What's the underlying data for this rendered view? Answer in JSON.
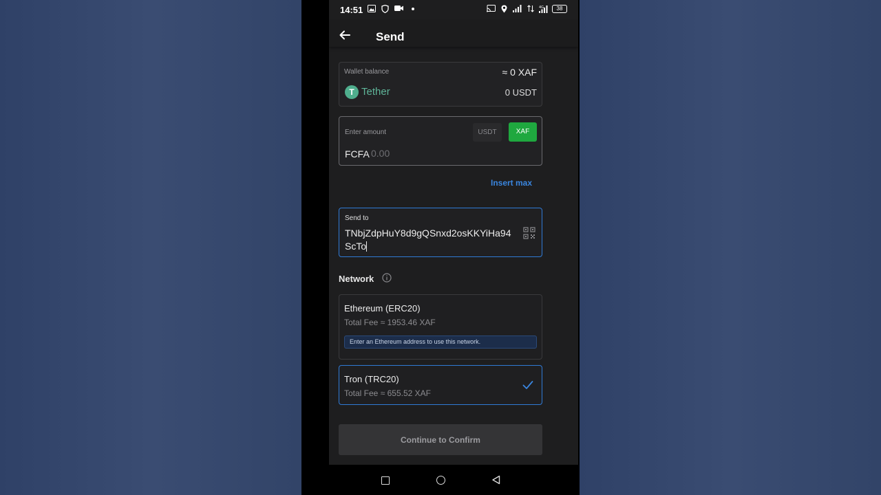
{
  "status_bar": {
    "time": "14:51",
    "battery": "38",
    "network_type": "4G"
  },
  "header": {
    "title": "Send",
    "back_icon": "arrow-left-icon"
  },
  "wallet": {
    "label": "Wallet balance",
    "fiat_balance": "≈ 0 XAF",
    "token_name": "Tether",
    "token_balance": "0 USDT",
    "token_icon_glyph": "T"
  },
  "amount": {
    "label": "Enter amount",
    "unit_options": [
      "USDT",
      "XAF"
    ],
    "selected_unit": "XAF",
    "currency_prefix": "FCFA",
    "placeholder": "0.00",
    "value": ""
  },
  "insert_max_label": "Insert max",
  "send_to": {
    "label": "Send to",
    "address": "TNbjZdpHuY8d9gQSnxd2osKKYiHa94ScTo"
  },
  "network": {
    "heading": "Network",
    "options": [
      {
        "name": "Ethereum (ERC20)",
        "fee": "Total Fee ≈ 1953.46 XAF",
        "warning": "Enter an Ethereum address to use this network.",
        "selected": false
      },
      {
        "name": "Tron (TRC20)",
        "fee": "Total Fee ≈ 655.52 XAF",
        "selected": true
      }
    ]
  },
  "continue_label": "Continue to Confirm",
  "colors": {
    "accent_green": "#1fa83f",
    "accent_blue": "#2f7bd8",
    "tether_green": "#4fae8d",
    "background": "#1e1e1f"
  }
}
